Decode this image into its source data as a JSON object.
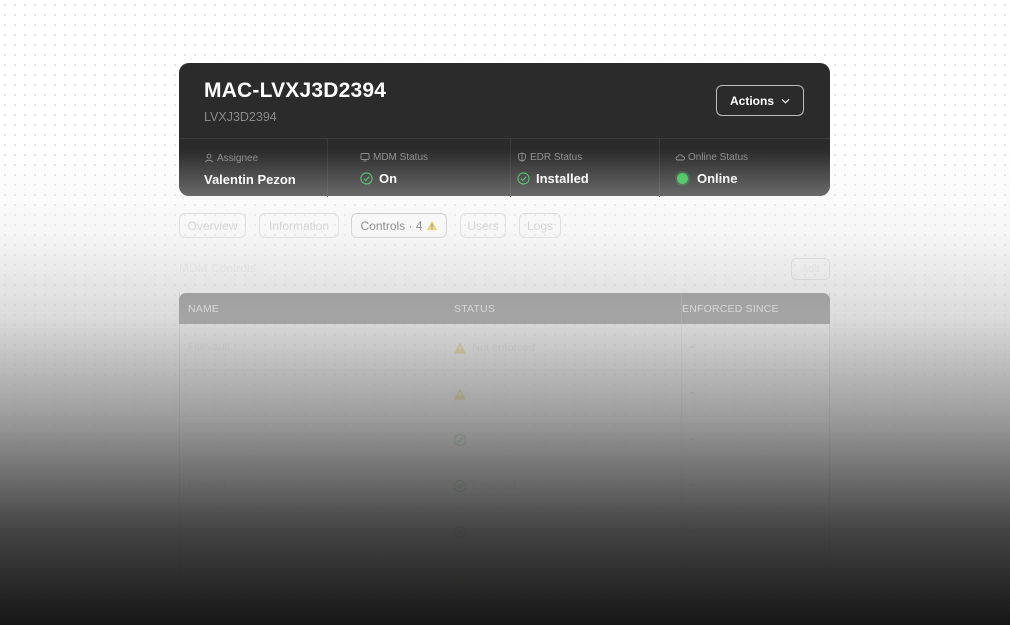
{
  "device": {
    "title": "MAC-LVXJ3D2394",
    "subtitle": "LVXJ3D2394",
    "actions_label": "Actions"
  },
  "status": {
    "assignee_label": "Assignee",
    "assignee_value": "Valentin Pezon",
    "mdm_label": "MDM Status",
    "mdm_value": "On",
    "edr_label": "EDR Status",
    "edr_value": "Installed",
    "online_label": "Online Status",
    "online_value": "Online"
  },
  "tabs": [
    {
      "label": "Overview"
    },
    {
      "label": "Information"
    },
    {
      "label": "Controls · 4"
    },
    {
      "label": "Users"
    },
    {
      "label": "Logs"
    }
  ],
  "section": {
    "title": "MDM Controls",
    "add_label": "Add"
  },
  "table": {
    "columns": [
      "NAME",
      "STATUS",
      "ENFORCED SINCE"
    ],
    "rows": [
      {
        "name": "FileVault",
        "status": "Not enforced",
        "icon": "warning-icon",
        "since": "-"
      },
      {
        "name": "",
        "status": "",
        "icon": "warning-icon",
        "since": "-"
      },
      {
        "name": "",
        "status": "",
        "icon": "check-circle-icon",
        "since": "-"
      },
      {
        "name": "Firewall",
        "status": "Enforced",
        "icon": "check-circle-icon",
        "since": "-"
      },
      {
        "name": "",
        "status": "",
        "icon": "check-circle-icon",
        "since": "-"
      },
      {
        "name": "",
        "status": "",
        "icon": "warning-icon",
        "since": ""
      }
    ]
  },
  "colors": {
    "card_bg": "#2b2b2b",
    "online_green": "#30c04d",
    "warning_yellow": "#e5b300",
    "check_green": "#39c25a"
  }
}
